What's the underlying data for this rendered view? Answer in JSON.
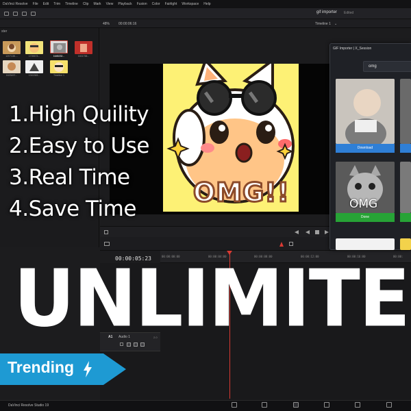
{
  "menubar": {
    "items": [
      "DaVinci Resolve",
      "File",
      "Edit",
      "Trim",
      "Timeline",
      "Clip",
      "Mark",
      "View",
      "Playback",
      "Fusion",
      "Color",
      "Fairlight",
      "Workspace",
      "Help"
    ]
  },
  "toolbar": {
    "app_title": "gif importer",
    "status": "Edited"
  },
  "subbar": {
    "zoom": "48%",
    "source_timecode": "00:00:06:16",
    "timeline_name": "Timeline 1"
  },
  "media_pool": {
    "header": "ster",
    "clips": [
      {
        "label": "1207138....",
        "color": "#c99a5a"
      },
      {
        "label": "1709673...",
        "color": "#f2e47a"
      },
      {
        "label": "1645232...",
        "color": "#dcdcdc"
      },
      {
        "label": "1601758...",
        "color": "#c0302a"
      },
      {
        "label": "1623497...",
        "color": "#e6d7c0"
      },
      {
        "label": "1341363...",
        "color": "#f0f0f0"
      },
      {
        "label": "Timeline 1",
        "color": "#f6e06a"
      }
    ]
  },
  "viewer": {
    "overlay_text": "OMG!!"
  },
  "features": [
    "1.High Quility",
    "2.Easy to Use",
    "3.Real Time",
    "4.Save Time"
  ],
  "timeline": {
    "timecode": "00:00:05:23",
    "ruler_labels": [
      "00:00:00:00",
      "00:00:04:00",
      "00:00:08:00",
      "00:00:12:00",
      "00:00:16:00",
      "00:00:"
    ],
    "audio_track": {
      "id": "A1",
      "name": "Audio 1",
      "channels": "2.0"
    }
  },
  "gif_importer": {
    "title": "GIF Importer | X_Session",
    "search_value": "omg",
    "cards": [
      {
        "button": "Download",
        "button_color": "#2f7fd6"
      },
      {
        "button": "Done",
        "button_color": "#27a336",
        "caption": "OMG"
      }
    ]
  },
  "headline": "UNLIMITED",
  "trending": {
    "label": "Trending"
  },
  "bottom_bar": {
    "version": "DaVinci Resolve Studio 19"
  }
}
